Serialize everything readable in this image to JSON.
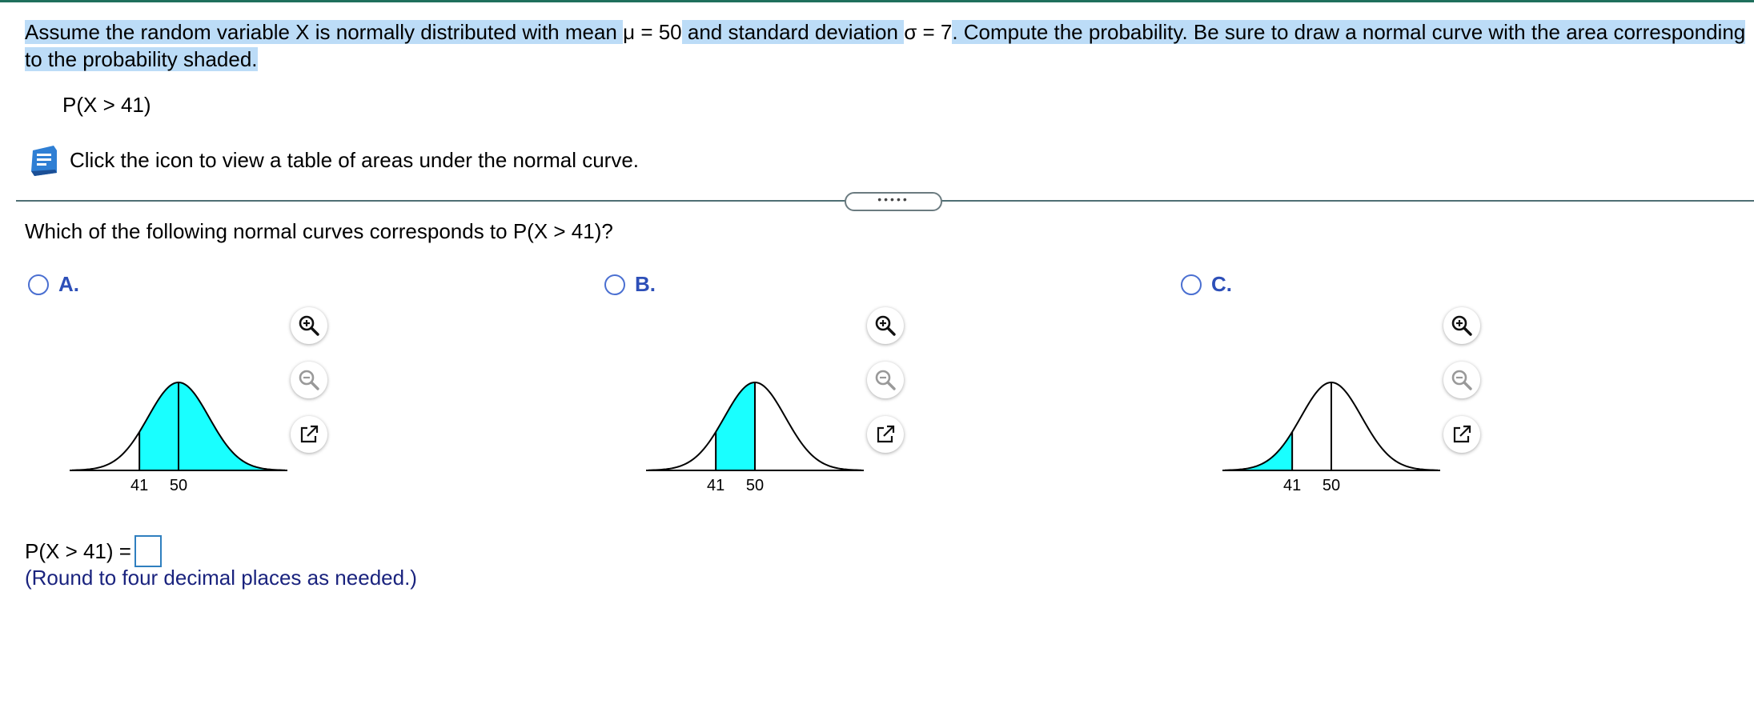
{
  "prompt": {
    "part1": "Assume the random variable X is normally distributed with mean ",
    "mu_expr": "μ = 50",
    "part2": " and standard deviation ",
    "sigma_expr": "σ = 7",
    "part3": ". Compute the probability. Be sure to draw a normal curve with the area corresponding to the probability shaded."
  },
  "probability_expr": "P(X > 41)",
  "table_link": {
    "text": "Click the icon to view a table of areas under the normal curve.",
    "icon": "book-icon"
  },
  "expander_label": "•••••",
  "question": "Which of the following normal curves corresponds to P(X > 41)?",
  "curve_params": {
    "mean": 50,
    "sd": 7
  },
  "options": [
    {
      "label": "A.",
      "shade": "right",
      "cutoff": 41,
      "tick_left": "41",
      "tick_right": "50"
    },
    {
      "label": "B.",
      "shade": "between",
      "cutoff": 41,
      "tick_left": "41",
      "tick_right": "50"
    },
    {
      "label": "C.",
      "shade": "left",
      "cutoff": 41,
      "tick_left": "41",
      "tick_right": "50"
    }
  ],
  "tools": {
    "zoom_in_icon": "zoom-in-icon",
    "zoom_out_icon": "zoom-out-icon",
    "popout_icon": "popout-icon"
  },
  "answer": {
    "label": "P(X > 41) =",
    "value": "",
    "note": "(Round to four decimal places as needed.)"
  },
  "colors": {
    "shade": "#19ffff",
    "highlight": "#bcdcf7",
    "option_label": "#2d4fb8",
    "note": "#1a237e",
    "input_border": "#2f7fbf"
  }
}
